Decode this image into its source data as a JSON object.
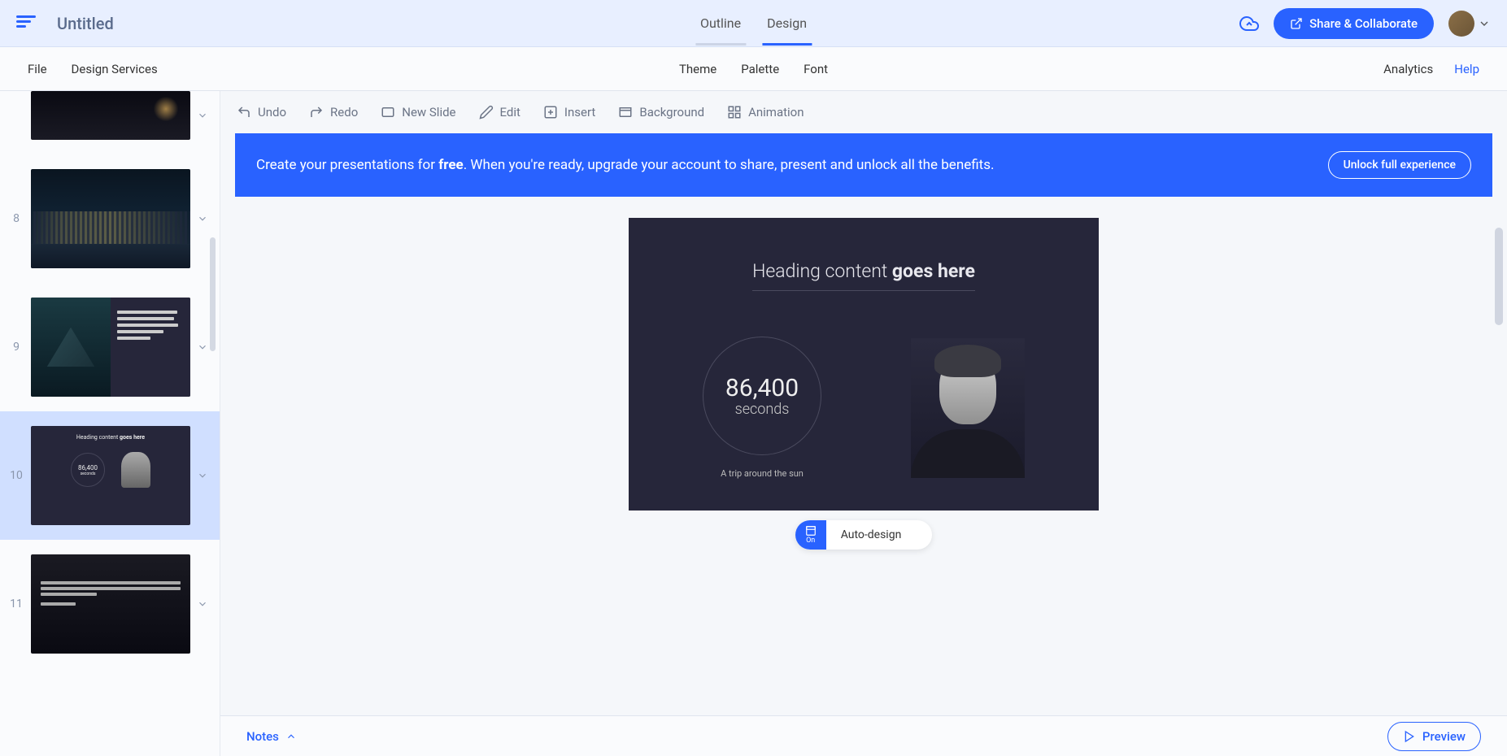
{
  "header": {
    "title": "Untitled",
    "tabs": {
      "outline": "Outline",
      "design": "Design"
    },
    "share_label": "Share & Collaborate"
  },
  "menubar": {
    "file": "File",
    "design_services": "Design Services",
    "theme": "Theme",
    "palette": "Palette",
    "font": "Font",
    "analytics": "Analytics",
    "help": "Help"
  },
  "toolbar": {
    "undo": "Undo",
    "redo": "Redo",
    "new_slide": "New Slide",
    "edit": "Edit",
    "insert": "Insert",
    "background": "Background",
    "animation": "Animation"
  },
  "banner": {
    "text_prefix": "Create your presentations for ",
    "text_bold": "free",
    "text_suffix": ". When you're ready, upgrade your account to share, present and unlock all the benefits.",
    "cta": "Unlock full experience"
  },
  "slide": {
    "heading_prefix": "Heading content ",
    "heading_bold": "goes here",
    "stat_value": "86,400",
    "stat_label": "seconds",
    "stat_caption": "A trip around the sun"
  },
  "thumbnails": {
    "t10_heading_prefix": "Heading content ",
    "t10_heading_bold": "goes here",
    "t10_value": "86,400",
    "t10_label": "seconds",
    "n8": "8",
    "n9": "9",
    "n10": "10",
    "n11": "11"
  },
  "auto_design": {
    "toggle": "On",
    "label": "Auto-design"
  },
  "footer": {
    "notes": "Notes",
    "preview": "Preview"
  }
}
